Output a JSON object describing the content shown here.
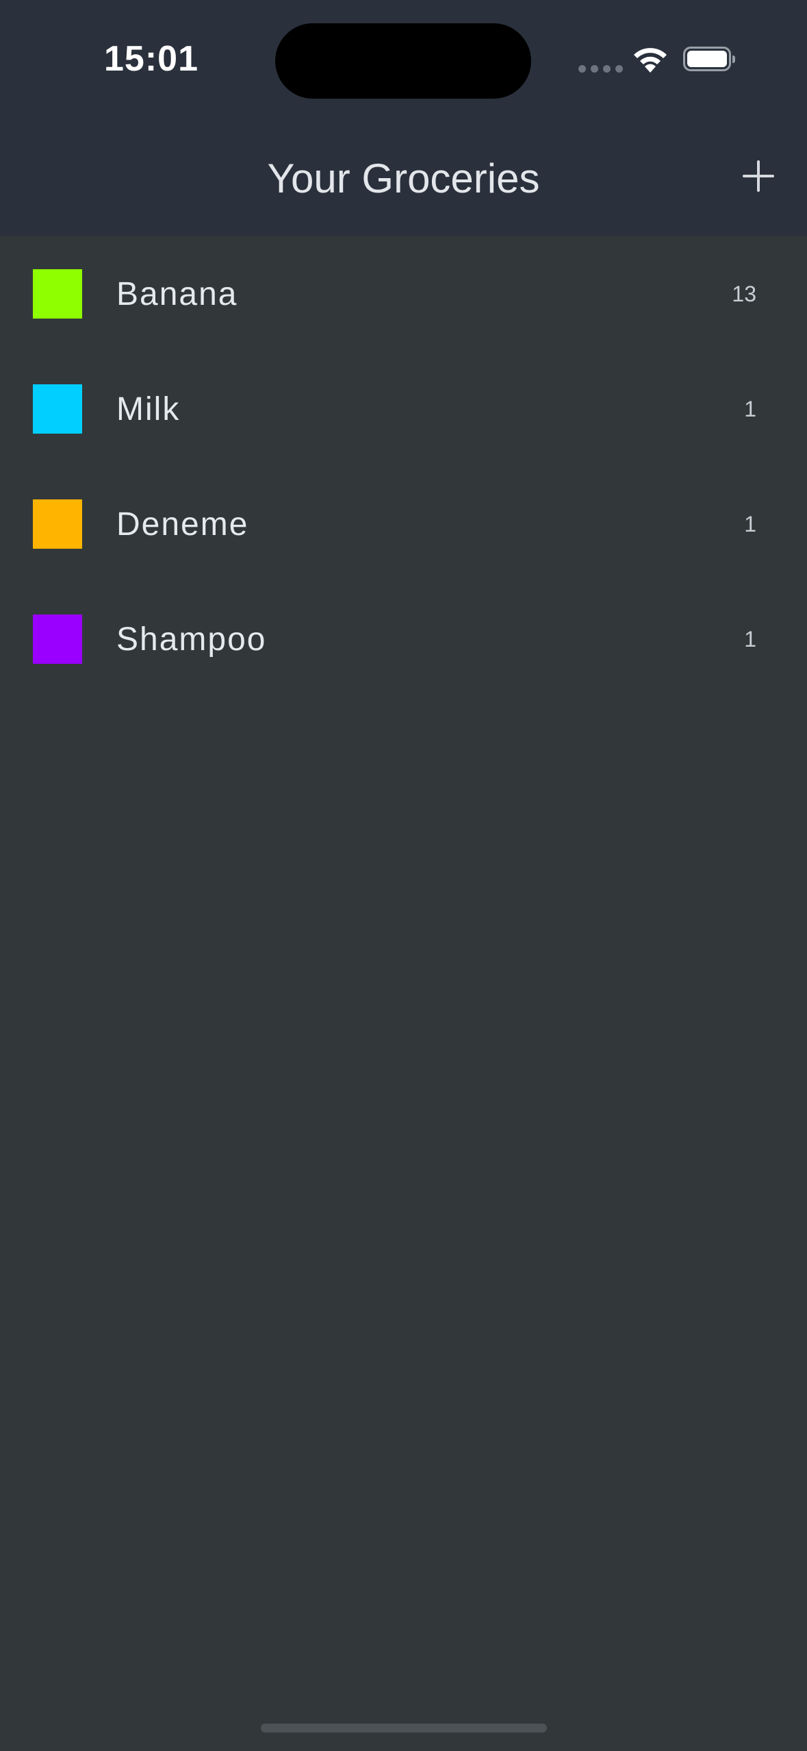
{
  "status_bar": {
    "time": "15:01",
    "icons": [
      "signal-dots-icon",
      "wifi-icon",
      "battery-icon"
    ]
  },
  "nav": {
    "title": "Your Groceries",
    "add_icon": "plus-icon"
  },
  "groceries": [
    {
      "name": "Banana",
      "quantity": "13",
      "color": "#8fff00"
    },
    {
      "name": "Milk",
      "quantity": "1",
      "color": "#00cfff"
    },
    {
      "name": "Deneme",
      "quantity": "1",
      "color": "#ffb400"
    },
    {
      "name": "Shampoo",
      "quantity": "1",
      "color": "#9900ff"
    }
  ],
  "colors": {
    "header_bg": "#2a313c",
    "body_bg": "#323839"
  }
}
